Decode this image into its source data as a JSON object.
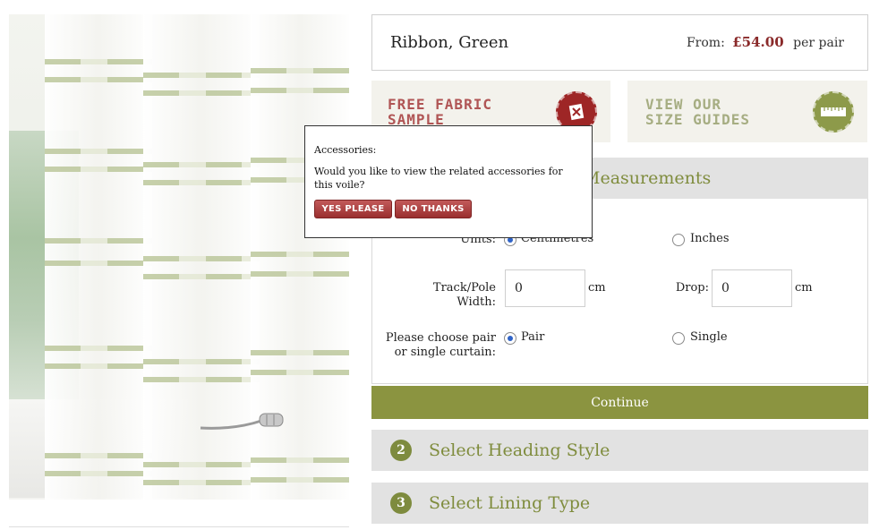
{
  "product": {
    "name": "Ribbon, Green",
    "from_label": "From:",
    "price": "£54.00",
    "price_suffix": "per pair"
  },
  "banners": {
    "fabric_line1": "FREE FABRIC",
    "fabric_line2": "SAMPLE",
    "size_line1": "VIEW OUR",
    "size_line2": "SIZE GUIDES"
  },
  "measurements": {
    "title": "Measurements",
    "units_label": "Units:",
    "unit_option_1": "Centimetres",
    "unit_option_2": "Inches",
    "width_label_1": "Track/Pole",
    "width_label_2": "Width:",
    "width_value": "0",
    "width_unit": "cm",
    "drop_label": "Drop:",
    "drop_value": "0",
    "drop_unit": "cm",
    "pair_label_1": "Please choose pair",
    "pair_label_2": "or single curtain:",
    "pair_option_1": "Pair",
    "pair_option_2": "Single"
  },
  "continue_label": "Continue",
  "steps": [
    {
      "num": "2",
      "title": "Select Heading Style"
    },
    {
      "num": "3",
      "title": "Select Lining Type"
    }
  ],
  "popup": {
    "title": "Accessories:",
    "message": "Would you like to view the related accessories for this voile?",
    "yes_label": "YES PLEASE",
    "no_label": "NO THANKS"
  },
  "colors": {
    "accent_green": "#8b9440",
    "price_red": "#8a2a2a",
    "button_red": "#9a2f2f"
  },
  "icons": {
    "fabric_badge": "scissors-fabric-icon",
    "size_badge": "tape-measure-icon",
    "radio_selected": "radio-checked-icon"
  }
}
